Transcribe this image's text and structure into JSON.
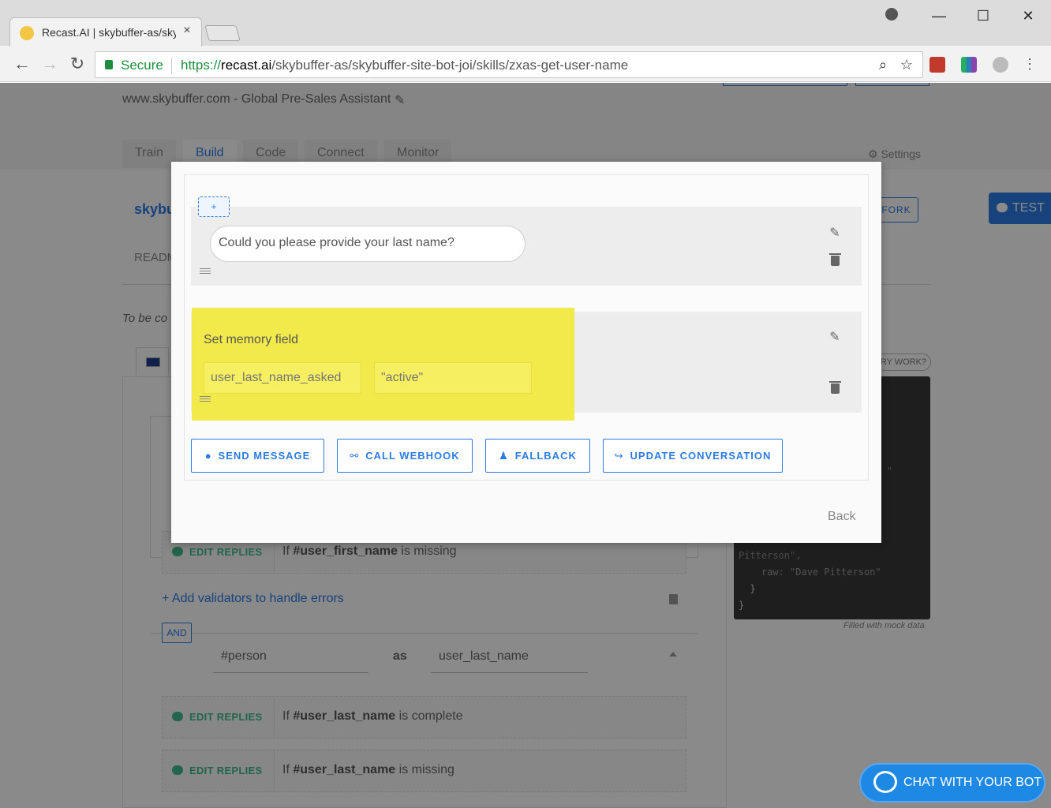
{
  "browser": {
    "tab_title": "Recast.AI | skybuffer-as/skybuffer-site-bot-joi",
    "secure_label": "Secure",
    "url_scheme": "https://",
    "url_host": "recast.ai",
    "url_path": "/skybuffer-as/skybuffer-site-bot-joi/skills/zxas-get-user-name",
    "window_buttons": [
      "minimize-icon",
      "maximize-icon",
      "close-icon"
    ]
  },
  "page": {
    "bot_description": "www.skybuffer.com - Global Pre-Sales Assistant",
    "tabs": [
      {
        "label": "Train"
      },
      {
        "label": "Build"
      },
      {
        "label": "Code"
      },
      {
        "label": "Connect"
      },
      {
        "label": "Monitor"
      }
    ],
    "settings_label": "Settings",
    "skill_name": "skybu",
    "fork_label": "FORK",
    "readme_label": "READM",
    "to_be_text": "To be co",
    "try_query_label": "RY WORK?",
    "json_lines": [
      "Pitterson\",",
      "    raw: \"Dave Pitterson\"",
      "  }",
      "}"
    ],
    "json_fragment": "\"",
    "mock_note": "Filled with mock data",
    "test_label": "TEST",
    "reply_edit_label": "EDIT REPLIES",
    "replies": [
      {
        "prefix": "If ",
        "variable": "#user_first_name",
        "suffix": " is missing"
      },
      {
        "prefix": "If ",
        "variable": "#user_last_name",
        "suffix": " is complete"
      },
      {
        "prefix": "If ",
        "variable": "#user_last_name",
        "suffix": " is missing"
      }
    ],
    "add_validators": "+ Add validators to handle errors",
    "and_label": "AND",
    "condition": {
      "entity": "#person",
      "as_label": "as",
      "variable": "user_last_name"
    }
  },
  "modal": {
    "add_label": "+",
    "message_text": "Could you please provide your last name?",
    "memory_title": "Set memory field",
    "memory_key_placeholder": "user_last_name_asked",
    "memory_value_placeholder": "\"active\"",
    "actions": [
      {
        "label": "SEND MESSAGE",
        "icon": "chat-icon",
        "glyph": "●"
      },
      {
        "label": "CALL WEBHOOK",
        "icon": "link-icon",
        "glyph": "⚯"
      },
      {
        "label": "FALLBACK",
        "icon": "user-icon",
        "glyph": "♟"
      },
      {
        "label": "UPDATE CONVERSATION",
        "icon": "redirect-icon",
        "glyph": "↪"
      }
    ],
    "back_label": "Back"
  },
  "chat_widget": {
    "label": "CHAT WITH YOUR BOT"
  },
  "colors": {
    "accent": "#2c7be5",
    "success": "#1e8e3e",
    "highlight": "#f2ea4a",
    "reply_green": "#3dbd8c"
  }
}
